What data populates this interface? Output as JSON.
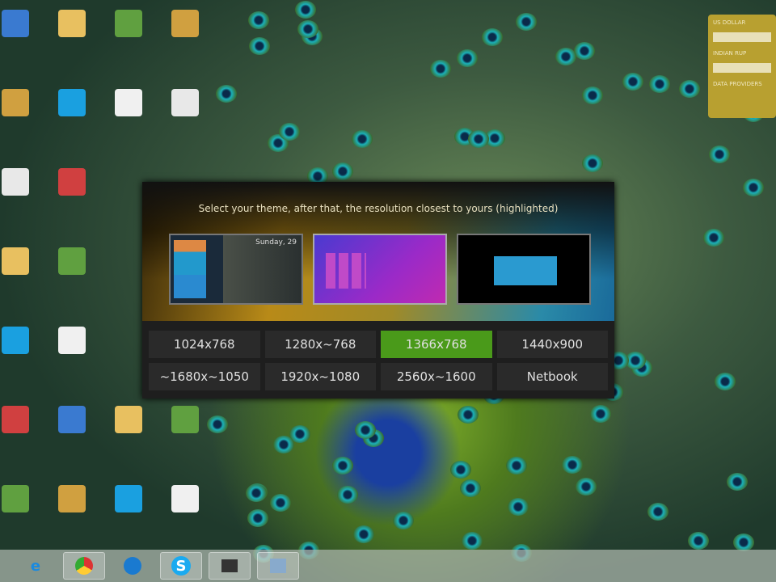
{
  "dialog": {
    "title": "Select your theme, after that, the resolution closest to yours (highlighted)",
    "themes": [
      {
        "name": "theme-1",
        "preview_text": "Sunday, 29"
      },
      {
        "name": "theme-2"
      },
      {
        "name": "theme-3"
      }
    ],
    "selected_theme": 1,
    "resolutions": [
      "1024x768",
      "1280x~768",
      "1366x768",
      "1440x900",
      "~1680x~1050",
      "1920x~1080",
      "2560x~1600",
      "Netbook"
    ],
    "selected_resolution": "1366x768",
    "highlight_color": "#4a9a1a"
  },
  "gadget": {
    "currency1": "US DOLLAR",
    "currency2": "INDIAN RUP",
    "footer": "DATA PROVIDERS"
  },
  "taskbar": {
    "items": [
      "internet-explorer",
      "chrome",
      "maxthon",
      "skype",
      "app",
      "app"
    ]
  }
}
